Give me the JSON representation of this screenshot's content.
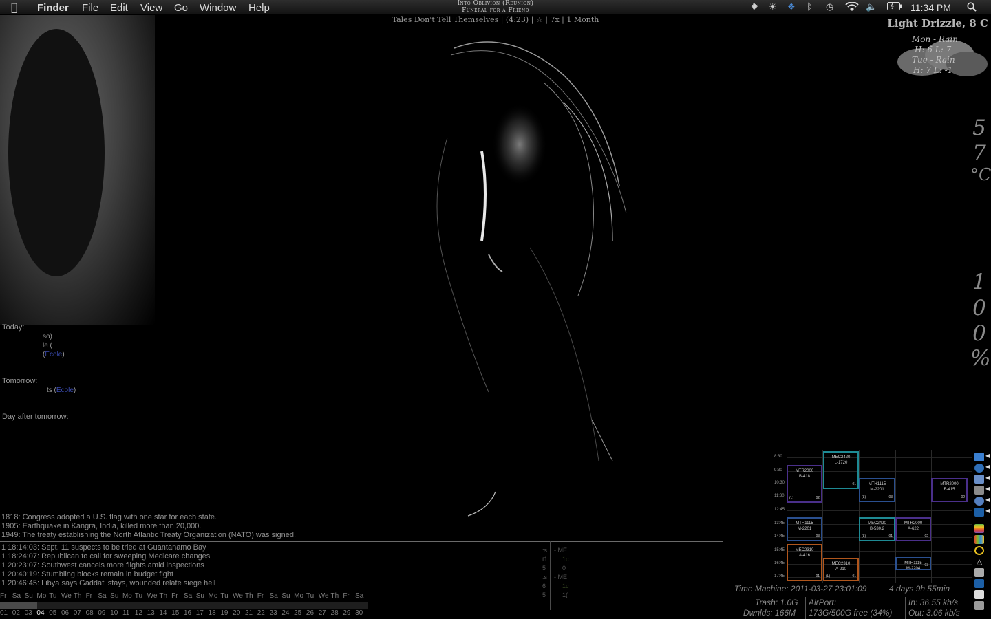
{
  "menubar": {
    "app": "Finder",
    "items": [
      "File",
      "Edit",
      "View",
      "Go",
      "Window",
      "Help"
    ],
    "now_playing_line1": "Into Oblivion (Reunion)",
    "now_playing_line2": "Funeral for a Friend",
    "clock": "11:34 PM"
  },
  "song_info": "Tales Don't Tell Themselves | (4:23) | ☆ | 7x | 1 Month",
  "weather": {
    "title": "Light Drizzle, 8 C",
    "forecast": [
      {
        "day": "Mon - Rain",
        "hl": "H: 6  L: 7"
      },
      {
        "day": "Tue - Rain",
        "hl": "H: 7  L: -1"
      }
    ]
  },
  "temperature": {
    "digits": [
      "5",
      "7",
      "°C"
    ]
  },
  "battery": {
    "digits": [
      "1",
      "0",
      "0",
      "%"
    ]
  },
  "agenda": {
    "today_label": "Today:",
    "today_lines": [
      "so)",
      "le (",
      "Ecole"
    ],
    "tomorrow_label": "Tomorrow:",
    "tomorrow_prefix": "ts (",
    "tomorrow_link": "Ecole",
    "tomorrow_suffix": ")",
    "day_after_label": "Day after tomorrow:"
  },
  "history": [
    "1818: Congress adopted a U.S. flag with one star for each state.",
    "1905: Earthquake in Kangra, India, killed more than 20,000.",
    "1949: The treaty establishing the North Atlantic Treaty Organization (NATO) was signed."
  ],
  "news": [
    "1 18:14:03: Sept. 11 suspects to be tried at Guantanamo Bay",
    "1 18:24:07: Republican to call for sweeping Medicare changes",
    "1 20:23:07: Southwest cancels more flights amid inspections",
    "1 20:40:19: Stumbling blocks remain in budget fight",
    "1 20:46:45: Libya says Gaddafi stays, wounded relate siege hell"
  ],
  "mini_col_a": [
    ":s",
    "t1",
    "5",
    ":s",
    "6",
    "5"
  ],
  "mini_col_b": [
    "- ME",
    "1c",
    "0",
    "- ME",
    "1c",
    "1("
  ],
  "calendar": {
    "days": [
      "Fr",
      "Sa",
      "Su",
      "Mo",
      "Tu",
      "We",
      "Th",
      "Fr",
      "Sa",
      "Su",
      "Mo",
      "Tu",
      "We",
      "Th",
      "Fr",
      "Sa",
      "Su",
      "Mo",
      "Tu",
      "We",
      "Th",
      "Fr",
      "Sa",
      "Su",
      "Mo",
      "Tu",
      "We",
      "Th",
      "Fr",
      "Sa"
    ],
    "numbers": [
      "01",
      "02",
      "03",
      "04",
      "05",
      "06",
      "07",
      "08",
      "09",
      "10",
      "11",
      "12",
      "13",
      "14",
      "15",
      "16",
      "17",
      "18",
      "19",
      "20",
      "21",
      "22",
      "23",
      "24",
      "25",
      "26",
      "27",
      "28",
      "29",
      "30"
    ],
    "today_index": 3,
    "progress_fraction": 0.1
  },
  "timetable": {
    "times": [
      "8:30",
      "9:30",
      "10:30",
      "11:30",
      "12:45",
      "13:45",
      "14:45",
      "15:45",
      "16:45",
      "17:45"
    ],
    "courses": [
      {
        "code": "MEC2420",
        "room": "L-1720",
        "group": "01",
        "lab": "",
        "color": "#1e8a94"
      },
      {
        "code": "MTR2000",
        "room": "B-418",
        "group": "02",
        "lab": "(L)",
        "color": "#4a2f8a"
      },
      {
        "code": "MTH1115",
        "room": "M-2201",
        "group": "03",
        "lab": "(L)",
        "color": "#2a4f8f"
      },
      {
        "code": "MTR2000",
        "room": "B-415",
        "group": "02",
        "lab": "",
        "color": "#4a2f8a"
      },
      {
        "code": "MTH1115",
        "room": "M-2201",
        "group": "03",
        "lab": "",
        "color": "#2a4f8f"
      },
      {
        "code": "MEC2420",
        "room": "B-530.2",
        "group": "01",
        "lab": "(L)",
        "color": "#1e8a94"
      },
      {
        "code": "MTR2000",
        "room": "A-622",
        "group": "02",
        "lab": "",
        "color": "#4a2f8a"
      },
      {
        "code": "MEC2310",
        "room": "A-416",
        "group": "01",
        "lab": "",
        "color": "#b0561c"
      },
      {
        "code": "MEC2310",
        "room": "A-210",
        "group": "01",
        "lab": "(L)",
        "color": "#b0561c"
      },
      {
        "code": "MTH1115",
        "room": "M-2204",
        "group": "03",
        "lab": "",
        "color": "#2a4f8f"
      }
    ]
  },
  "system": {
    "time_machine": "Time Machine: 2011-03-27 23:01:09",
    "time_machine_ago": "4 days 9h 55min",
    "trash": "Trash: 1.0G",
    "downloads": "Dwnlds: 166M",
    "airport_label": "AirPort:",
    "airport_space": "173G/500G free (34%)",
    "net_in": "In: 36.55 kb/s",
    "net_out": "Out: 3.06 kb/s"
  },
  "icons": {
    "tray": [
      "ai-icon",
      "brightness-icon",
      "dropbox-icon",
      "bluetooth-icon",
      "time-machine-icon",
      "wifi-icon",
      "volume-icon",
      "battery-icon",
      "spotlight-icon"
    ],
    "dock": [
      "finder-icon",
      "safari-icon",
      "preview-icon",
      "mail-icon",
      "itunes-icon",
      "photoshop-icon",
      "apple-icon",
      "windows-icon",
      "opera-icon",
      "inkscape-icon",
      "downloads-icon",
      "photoshop2-icon",
      "documents-icon",
      "trash-icon"
    ]
  }
}
